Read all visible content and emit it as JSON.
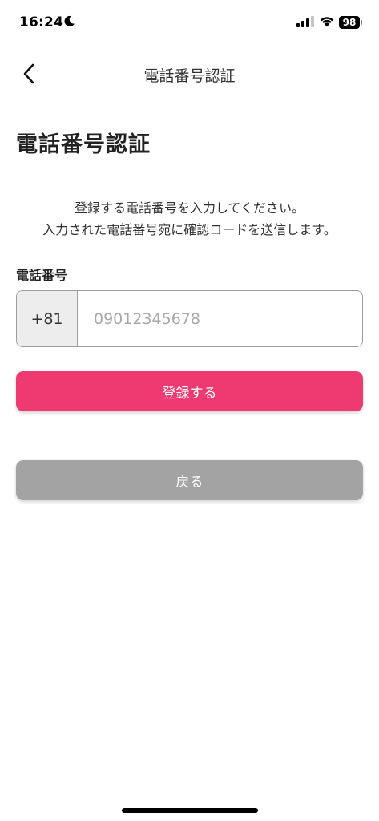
{
  "status_bar": {
    "time": "16:24",
    "battery_level": "98",
    "icons": [
      "moon-icon",
      "signal-icon",
      "wifi-icon",
      "battery-icon"
    ]
  },
  "nav": {
    "title": "電話番号認証",
    "back_icon": "chevron-left-icon"
  },
  "page": {
    "title": "電話番号認証",
    "description_line1": "登録する電話番号を入力してください。",
    "description_line2": "入力された電話番号宛に確認コードを送信します。"
  },
  "phone_form": {
    "label": "電話番号",
    "country_code": "+81",
    "value": "",
    "placeholder": "09012345678"
  },
  "buttons": {
    "register_label": "登録する",
    "back_label": "戻る"
  },
  "colors": {
    "primary": "#ef3a71",
    "secondary": "#a3a3a3",
    "input_border": "#9e9e9e",
    "country_code_bg": "#ededed"
  }
}
